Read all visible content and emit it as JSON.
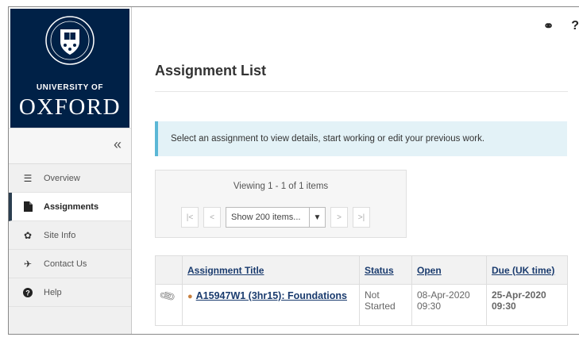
{
  "branding": {
    "line1": "UNIVERSITY OF",
    "line2": "OXFORD",
    "color": "#002147"
  },
  "sidebar": {
    "collapse_icon": "«",
    "items": [
      {
        "label": "Overview",
        "icon": "list-icon",
        "glyph": "☰",
        "active": false
      },
      {
        "label": "Assignments",
        "icon": "document-icon",
        "glyph": "▇",
        "active": true
      },
      {
        "label": "Site Info",
        "icon": "gear-icon",
        "glyph": "✿",
        "active": false
      },
      {
        "label": "Contact Us",
        "icon": "send-icon",
        "glyph": "✈",
        "active": false
      },
      {
        "label": "Help",
        "icon": "help-icon",
        "glyph": "❓",
        "active": false
      }
    ]
  },
  "header": {
    "link_icon": "⚭",
    "help_icon": "?"
  },
  "page": {
    "title": "Assignment List",
    "info": "Select an assignment to view details, start working or edit your previous work."
  },
  "pager": {
    "viewing": "Viewing 1 - 1 of 1 items",
    "first": "|<",
    "prev": "<",
    "select_value": "Show 200 items...",
    "next": ">",
    "last": ">|"
  },
  "table": {
    "headers": {
      "title": "Assignment Title",
      "status": "Status",
      "open": "Open",
      "due": "Due (UK time)"
    },
    "rows": [
      {
        "title": "A15947W1 (3hr15): Foundations",
        "status": "Not Started",
        "open": "08-Apr-2020 09:30",
        "due": "25-Apr-2020 09:30"
      }
    ]
  },
  "colors": {
    "link": "#1a3b6e",
    "due": "#b31b1b",
    "info_bg": "#e3f2f7",
    "info_border": "#5bb7d6"
  }
}
